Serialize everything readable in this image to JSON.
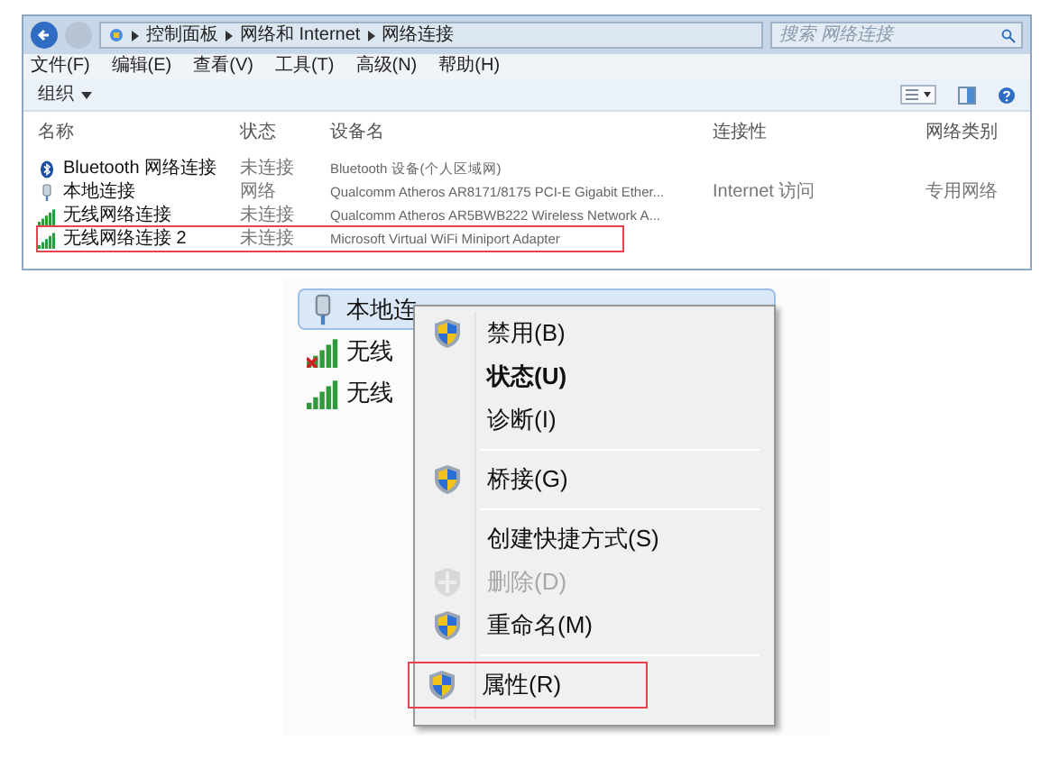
{
  "window": {
    "breadcrumbs": [
      "控制面板",
      "网络和 Internet",
      "网络连接"
    ],
    "search": {
      "placeholder": "搜索 网络连接"
    }
  },
  "menu_bar": [
    "文件(F)",
    "编辑(E)",
    "查看(V)",
    "工具(T)",
    "高级(N)",
    "帮助(H)"
  ],
  "toolbar": {
    "organize": "组织"
  },
  "table": {
    "columns": [
      "名称",
      "状态",
      "设备名",
      "连接性",
      "网络类别"
    ],
    "rows": [
      {
        "kind": "bluetooth",
        "cells": [
          "Bluetooth 网络连接",
          "未连接",
          "Bluetooth 设备(个人区域网)",
          "",
          ""
        ],
        "highlighted": false
      },
      {
        "kind": "wired",
        "cells": [
          "本地连接",
          "网络",
          "Qualcomm Atheros AR8171/8175 PCI-E Gigabit Ether...",
          "Internet 访问",
          "专用网络"
        ],
        "highlighted": false
      },
      {
        "kind": "wireless",
        "cells": [
          "无线网络连接",
          "未连接",
          "Qualcomm Atheros AR5BWB222 Wireless Network A...",
          "",
          ""
        ],
        "highlighted": false
      },
      {
        "kind": "wireless",
        "cells": [
          "无线网络连接 2",
          "未连接",
          "Microsoft Virtual WiFi Miniport Adapter",
          "",
          ""
        ],
        "highlighted": true
      }
    ]
  },
  "zoomed_list": [
    {
      "kind": "wired",
      "label": "本地连",
      "selected": true
    },
    {
      "kind": "wireless_x",
      "label": "无线",
      "selected": false
    },
    {
      "kind": "wireless",
      "label": "无线",
      "selected": false
    }
  ],
  "context_menu": [
    {
      "kind": "shield",
      "label": "禁用(B)",
      "bold": false,
      "disabled": false,
      "separator_after": false,
      "highlighted": false
    },
    {
      "kind": "plain",
      "label": "状态(U)",
      "bold": true,
      "disabled": false,
      "separator_after": false,
      "highlighted": false
    },
    {
      "kind": "plain",
      "label": "诊断(I)",
      "bold": false,
      "disabled": false,
      "separator_after": true,
      "highlighted": false
    },
    {
      "kind": "shield",
      "label": "桥接(G)",
      "bold": false,
      "disabled": false,
      "separator_after": true,
      "highlighted": false
    },
    {
      "kind": "plain",
      "label": "创建快捷方式(S)",
      "bold": false,
      "disabled": false,
      "separator_after": false,
      "highlighted": false
    },
    {
      "kind": "shield",
      "label": "删除(D)",
      "bold": false,
      "disabled": true,
      "separator_after": false,
      "highlighted": false
    },
    {
      "kind": "shield",
      "label": "重命名(M)",
      "bold": false,
      "disabled": false,
      "separator_after": true,
      "highlighted": false
    },
    {
      "kind": "shield",
      "label": "属性(R)",
      "bold": false,
      "disabled": false,
      "separator_after": false,
      "highlighted": true
    }
  ]
}
